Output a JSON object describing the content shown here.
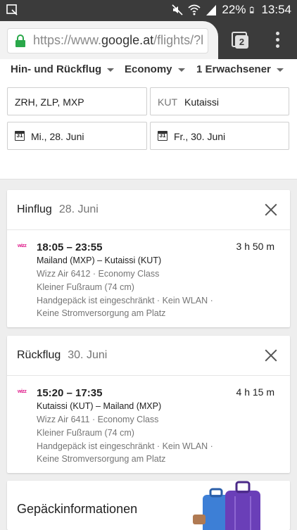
{
  "status_bar": {
    "battery": "22%",
    "time": "13:54"
  },
  "browser": {
    "url_prefix": "https://www.",
    "url_host": "google.at",
    "url_path": "/flights/?l",
    "tab_count": "2"
  },
  "search": {
    "trip_type": "Hin- und Rückflug",
    "cabin_class": "Economy",
    "passengers": "1 Erwachsener",
    "origin": "ZRH, ZLP, MXP",
    "destination_code": "KUT",
    "destination_name": "Kutaissi",
    "depart_date": "Mi., 28. Juni",
    "return_date": "Fr., 30. Juni",
    "calendar_icon_text": "31"
  },
  "outbound": {
    "title": "Hinflug",
    "date": "28. Juni",
    "airline_logo": "wizz",
    "time": "18:05 – 23:55",
    "duration": "3 h 50 m",
    "route": "Mailand (MXP) – Kutaissi (KUT)",
    "flight_info": "Wizz Air 6412 · Economy Class",
    "legroom": "Kleiner Fußraum (74 cm)",
    "amenities_1": "Handgepäck ist eingeschränkt · Kein WLAN ·",
    "amenities_2": "Keine Stromversorgung am Platz"
  },
  "return": {
    "title": "Rückflug",
    "date": "30. Juni",
    "airline_logo": "wizz",
    "time": "15:20 – 17:35",
    "duration": "4 h 15 m",
    "route": "Kutaissi (KUT) – Mailand (MXP)",
    "flight_info": "Wizz Air 6411 · Economy Class",
    "legroom": "Kleiner Fußraum (74 cm)",
    "amenities_1": "Handgepäck ist eingeschränkt · Kein WLAN ·",
    "amenities_2": "Keine Stromversorgung am Platz"
  },
  "baggage": {
    "title": "Gepäckinformationen"
  }
}
